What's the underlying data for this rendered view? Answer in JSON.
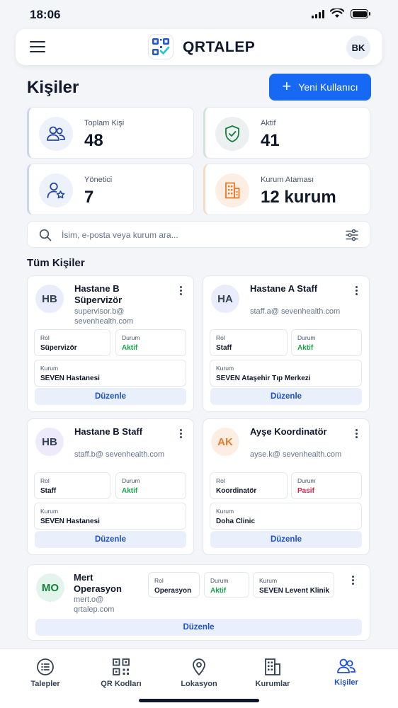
{
  "status_bar": {
    "time": "18:06"
  },
  "header": {
    "app_name": "QRTALEP",
    "avatar_initials": "BK"
  },
  "page": {
    "title": "Kişiler",
    "new_user_label": "Yeni Kullanıcı"
  },
  "stats": [
    {
      "label": "Toplam Kişi",
      "value": "48",
      "icon": "users-icon"
    },
    {
      "label": "Aktif",
      "value": "41",
      "icon": "shield-check-icon"
    },
    {
      "label": "Yönetici",
      "value": "7",
      "icon": "user-star-icon"
    },
    {
      "label": "Kurum Ataması",
      "value": "12 kurum",
      "icon": "building-icon"
    }
  ],
  "search": {
    "placeholder": "İsim, e-posta veya kurum ara..."
  },
  "section_title": "Tüm Kişiler",
  "field_labels": {
    "role": "Rol",
    "status": "Durum",
    "institution": "Kurum"
  },
  "edit_label": "Düzenle",
  "people": [
    {
      "initials": "HB",
      "name": "Hastane B Süpervizör",
      "email": "supervisor.b@ sevenhealth.com",
      "role": "Süpervizör",
      "status": "Aktif",
      "institution": "SEVEN Hastanesi",
      "avatar_bg": "#e8ecfb",
      "avatar_fg": "#334155"
    },
    {
      "initials": "HA",
      "name": "Hastane A Staff",
      "email": "staff.a@ sevenhealth.com",
      "role": "Staff",
      "status": "Aktif",
      "institution": "SEVEN Ataşehir Tıp Merkezi",
      "avatar_bg": "#e8ecfb",
      "avatar_fg": "#334155"
    },
    {
      "initials": "HB",
      "name": "Hastane B Staff",
      "email": "staff.b@ sevenhealth.com",
      "role": "Staff",
      "status": "Aktif",
      "institution": "SEVEN Hastanesi",
      "avatar_bg": "#eceafb",
      "avatar_fg": "#334155"
    },
    {
      "initials": "AK",
      "name": "Ayşe Koordinatör",
      "email": "ayse.k@ sevenhealth.com",
      "role": "Koordinatör",
      "status": "Pasif",
      "institution": "Doha Clinic",
      "avatar_bg": "#fdeee3",
      "avatar_fg": "#ea7a2c"
    },
    {
      "initials": "MO",
      "name": "Mert Operasyon",
      "email": "mert.o@ qrtalep.com",
      "role": "Operasyon",
      "status": "Aktif",
      "institution": "SEVEN Levent Klinik",
      "avatar_bg": "#e3f4ec",
      "avatar_fg": "#15803d"
    }
  ],
  "tabs": [
    {
      "label": "Talepler",
      "icon": "list-icon"
    },
    {
      "label": "QR Kodları",
      "icon": "qr-code-icon"
    },
    {
      "label": "Lokasyon",
      "icon": "location-pin-icon"
    },
    {
      "label": "Kurumlar",
      "icon": "building-icon"
    },
    {
      "label": "Kişiler",
      "icon": "users-icon",
      "active": true
    }
  ],
  "colors": {
    "primary": "#1768f2",
    "active_green": "#16a34a",
    "passive_red": "#e11d48"
  }
}
